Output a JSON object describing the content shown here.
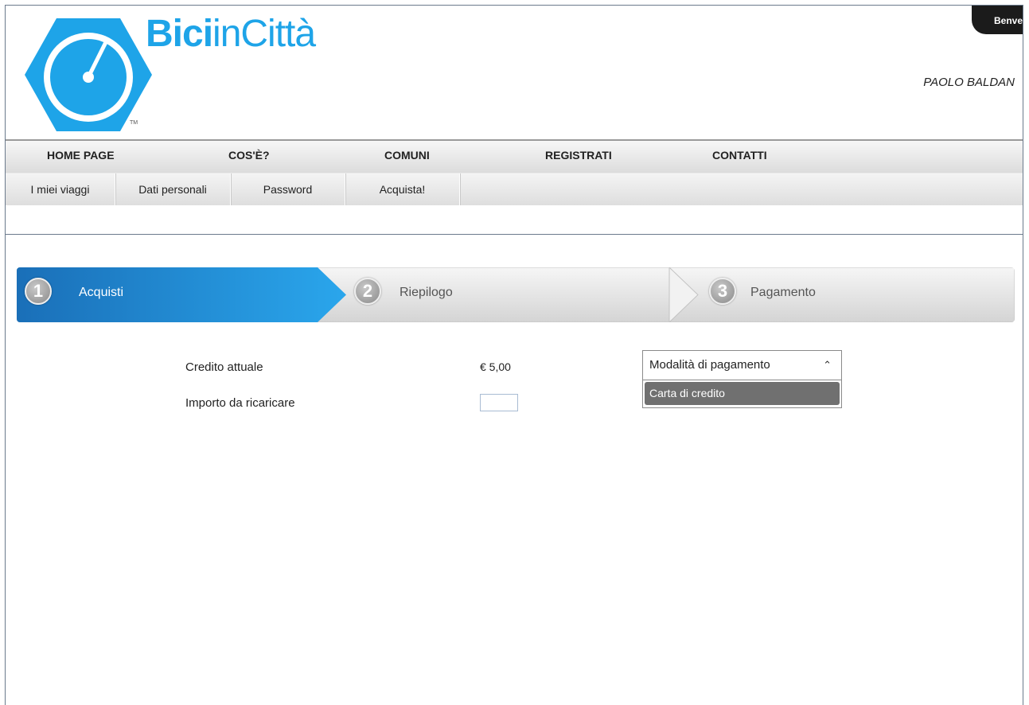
{
  "brand": {
    "bold": "Bici",
    "rest": "inCittà",
    "tm": "TM"
  },
  "header": {
    "welcome": "Benve",
    "user": "PAOLO BALDAN"
  },
  "main_nav": [
    "HOME PAGE",
    "COS'È?",
    "COMUNI",
    "REGISTRATI",
    "CONTATTI"
  ],
  "sub_nav": [
    "I miei viaggi",
    "Dati personali",
    "Password",
    "Acquista!"
  ],
  "wizard": {
    "steps": [
      {
        "num": "1",
        "label": "Acquisti"
      },
      {
        "num": "2",
        "label": "Riepilogo"
      },
      {
        "num": "3",
        "label": "Pagamento"
      }
    ],
    "active_step": 1
  },
  "form": {
    "credit_label": "Credito attuale",
    "credit_value": "€ 5,00",
    "amount_label": "Importo da ricaricare",
    "amount_value": ""
  },
  "payment_dropdown": {
    "label": "Modalità di pagamento",
    "options": [
      "Carta di credito"
    ]
  },
  "colors": {
    "brand_blue": "#1ea4e8",
    "active_step": "#1a7fc8"
  }
}
